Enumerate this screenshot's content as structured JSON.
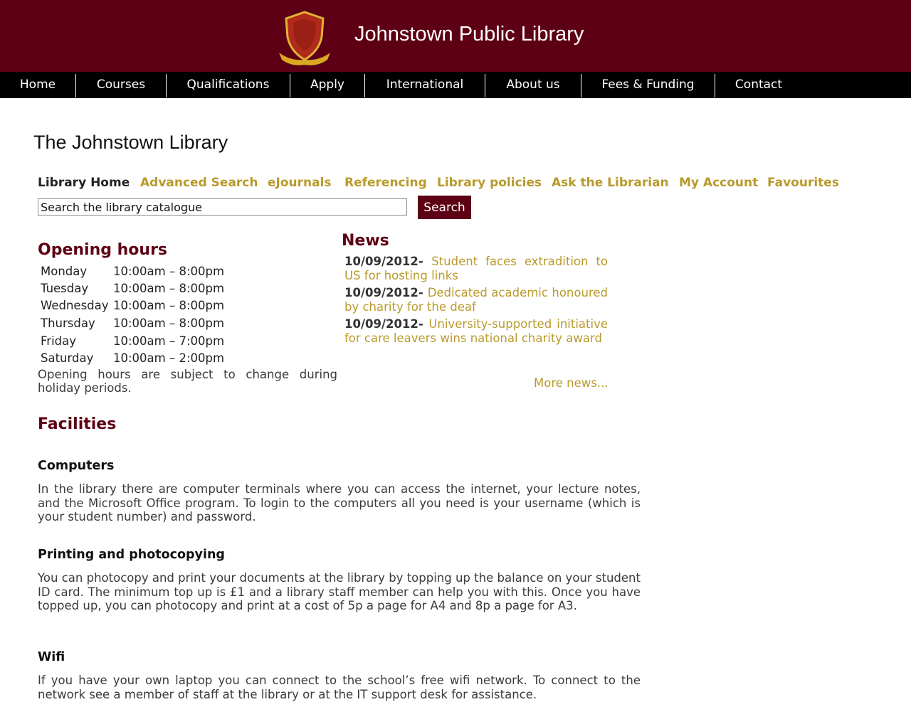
{
  "header": {
    "site_title": "Johnstown Public Library",
    "logo_icon": "shield-crest-icon",
    "brand_color": "#5e0015"
  },
  "nav": {
    "items": [
      "Home",
      "Courses",
      "Qualifications",
      "Apply",
      "International",
      "About us",
      "Fees & Funding",
      "Contact"
    ]
  },
  "page": {
    "title": "The Johnstown Library"
  },
  "library_nav": {
    "items": [
      "Library Home",
      "Advanced Search",
      "eJournals",
      "Referencing",
      "Library policies",
      "Ask the Librarian",
      "My Account",
      "Favourites"
    ],
    "selected": "Library Home"
  },
  "search": {
    "value": "Search the library catalogue",
    "button_label": "Search"
  },
  "opening_hours": {
    "heading": "Opening hours",
    "rows": [
      {
        "day": "Monday",
        "time": "10:00am – 8:00pm"
      },
      {
        "day": "Tuesday",
        "time": "10:00am – 8:00pm"
      },
      {
        "day": "Wednesday",
        "time": "10:00am – 8:00pm"
      },
      {
        "day": "Thursday",
        "time": "10:00am – 8:00pm"
      },
      {
        "day": "Friday",
        "time": "10:00am – 7:00pm"
      },
      {
        "day": "Saturday",
        "time": "10:00am – 2:00pm"
      }
    ],
    "note": "Opening hours are subject to change during holiday periods."
  },
  "news": {
    "heading": "News",
    "items": [
      {
        "date": "10/09/2012",
        "separator": "- ",
        "title": "Student faces extradition to US for hosting links"
      },
      {
        "date": "10/09/2012",
        "separator": "- ",
        "title": "Dedicated academic honoured by charity for the deaf"
      },
      {
        "date": "10/09/2012",
        "separator": "- ",
        "title": "University-supported initiative for care leavers wins national charity award"
      }
    ],
    "more_label": "More news..."
  },
  "facilities": {
    "heading": "Facilities",
    "sections": [
      {
        "title": "Computers",
        "body": "In the library there are computer terminals where you can access the internet, your lecture notes, and the Microsoft Office program. To login to the computers all you need is your username (which is your student number) and password."
      },
      {
        "title": "Printing and photocopying",
        "body": "You can photocopy and print your documents at the library by topping up the balance on your student ID card. The minimum top up is £1 and a library staff member can help you with this. Once you have topped up, you can photocopy and print at a cost of 5p a page for A4 and 8p a page for A3."
      },
      {
        "title": "Wifi",
        "body": "If you have your own laptop you can connect to the school’s free wifi network. To connect to the network see a member of staff at the library or at the IT support desk for assistance."
      }
    ]
  }
}
